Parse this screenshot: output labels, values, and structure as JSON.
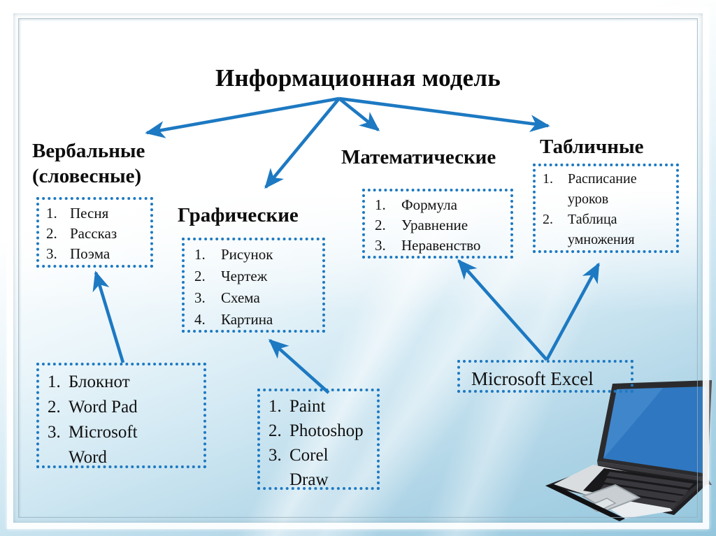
{
  "title": "Информационная модель",
  "accent_color": "#1d79c2",
  "text_color": "#0d0d0d",
  "branches": {
    "verbal": {
      "heading_line1": "Вербальные",
      "heading_line2": "(словесные)",
      "items": [
        {
          "num": "1.",
          "text": "Песня"
        },
        {
          "num": "2.",
          "text": "Рассказ"
        },
        {
          "num": "3.",
          "text": "Поэма"
        }
      ]
    },
    "graphic": {
      "heading": "Графические",
      "items": [
        {
          "num": "1.",
          "text": "Рисунок"
        },
        {
          "num": "2.",
          "text": "Чертеж"
        },
        {
          "num": "3.",
          "text": "Схема"
        },
        {
          "num": "4.",
          "text": "Картина"
        }
      ]
    },
    "math": {
      "heading": "Математические",
      "items": [
        {
          "num": "1.",
          "text": "Формула"
        },
        {
          "num": "2.",
          "text": "Уравнение"
        },
        {
          "num": "3.",
          "text": "Неравенство"
        }
      ]
    },
    "table": {
      "heading": "Табличные",
      "items": [
        {
          "num": "1.",
          "text": "Расписание"
        },
        {
          "num": "",
          "text": "уроков"
        },
        {
          "num": "2.",
          "text": "Таблица"
        },
        {
          "num": "",
          "text": "умножения"
        }
      ]
    }
  },
  "tools": {
    "text_editors": [
      {
        "num": "1.",
        "text": "Блокнот"
      },
      {
        "num": "2.",
        "text": "Word Pad"
      },
      {
        "num": "3.",
        "text": "Microsoft"
      },
      {
        "num": "",
        "text": "Word"
      }
    ],
    "graphic_editors": [
      {
        "num": "1.",
        "text": "Paint"
      },
      {
        "num": "2.",
        "text": "Photoshop"
      },
      {
        "num": "3.",
        "text": "Corel"
      },
      {
        "num": "",
        "text": "Draw"
      }
    ],
    "spreadsheet": "Microsoft Excel"
  },
  "illustration": {
    "laptop_screen_color": "#2f77c0",
    "laptop_body_color": "#2b2b2e"
  }
}
